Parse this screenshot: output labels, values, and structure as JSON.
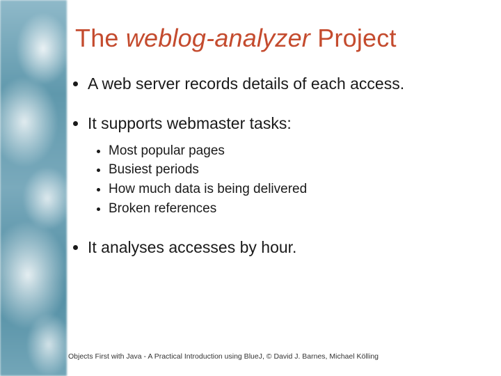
{
  "title": {
    "pre": "The ",
    "italic": "weblog-analyzer",
    "post": " Project"
  },
  "bullets": [
    {
      "text": "A web server records details of each access.",
      "sub": []
    },
    {
      "text": "It supports webmaster tasks:",
      "sub": [
        "Most popular pages",
        "Busiest periods",
        "How much data is being delivered",
        "Broken references"
      ]
    },
    {
      "text": "It analyses accesses by hour.",
      "sub": []
    }
  ],
  "footer": "Objects First with Java - A Practical Introduction using BlueJ, © David J. Barnes, Michael Kölling"
}
